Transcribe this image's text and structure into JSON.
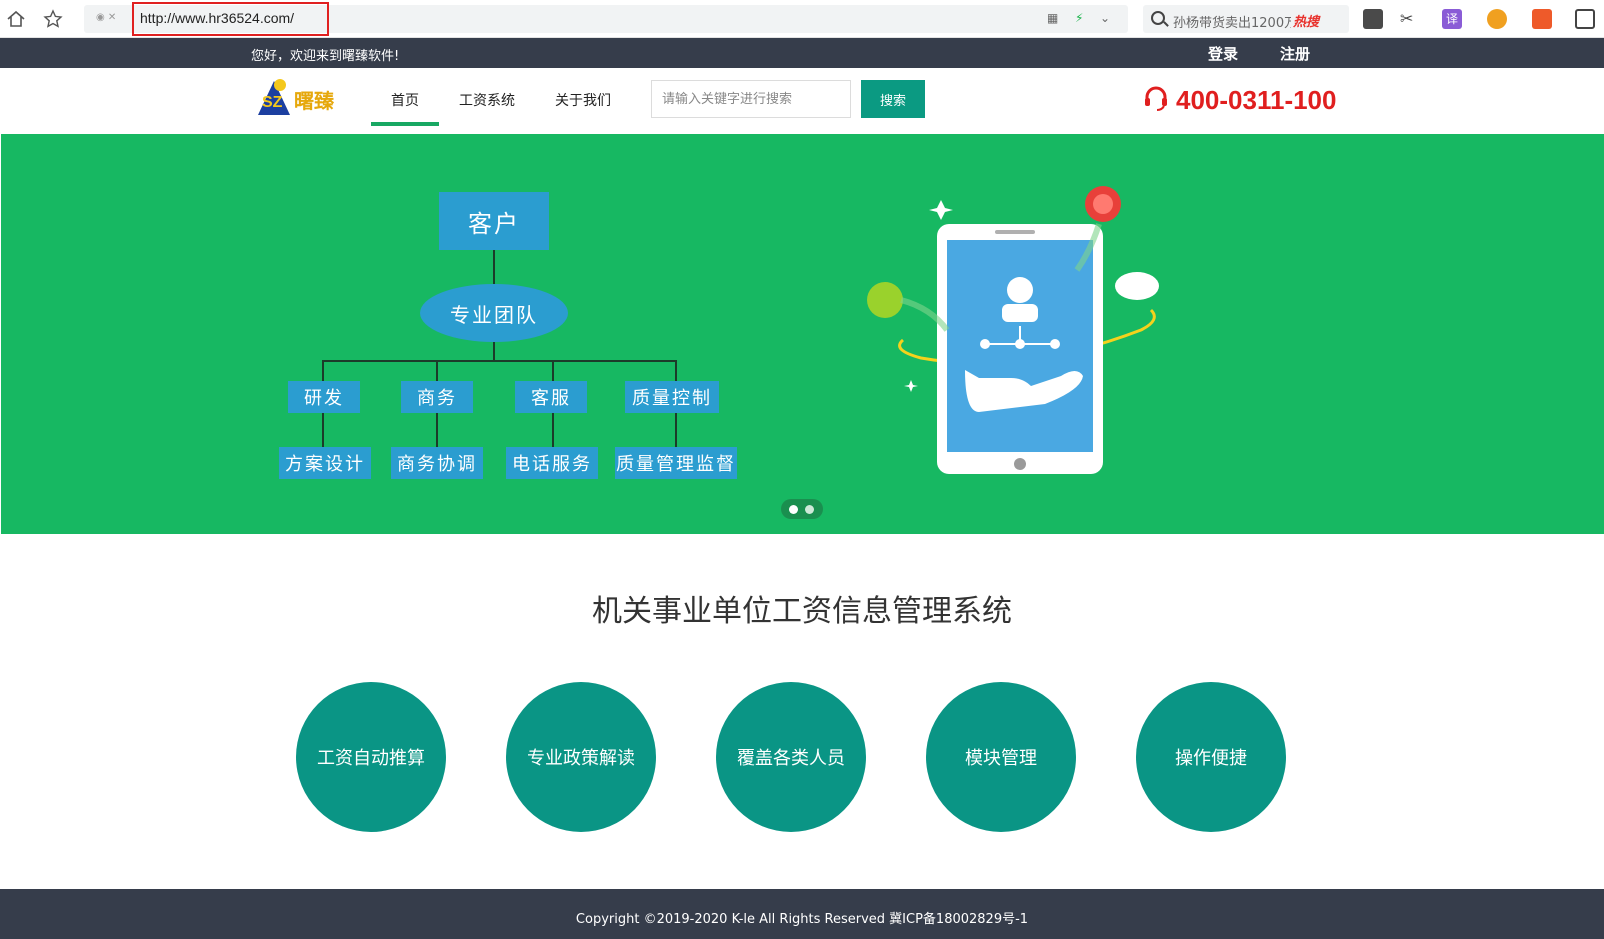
{
  "browser": {
    "url": "http://www.hr36524.com/",
    "search_text": "孙杨带货卖出1200万",
    "search_hot": "热搜"
  },
  "topbar": {
    "welcome": "您好，欢迎来到曙臻软件!",
    "login": "登录",
    "register": "注册"
  },
  "nav": {
    "items": [
      "首页",
      "工资系统",
      "关于我们"
    ],
    "search_placeholder": "请输入关键字进行搜索",
    "search_button": "搜索",
    "phone": "400-0311-100",
    "logo_text": "曙臻"
  },
  "banner": {
    "top": "客户",
    "team": "专业团队",
    "depts": [
      "研发",
      "商务",
      "客服",
      "质量控制"
    ],
    "tasks": [
      "方案设计",
      "商务协调",
      "电话服务",
      "质量管理监督"
    ]
  },
  "main": {
    "headline": "机关事业单位工资信息管理系统",
    "features": [
      "工资自动推算",
      "专业政策解读",
      "覆盖各类人员",
      "模块管理",
      "操作便捷"
    ]
  },
  "footer": {
    "copyright": "Copyright ©2019-2020 K-le All Rights Reserved  冀ICP备18002829号-1"
  },
  "colors": {
    "banner": "#17b862",
    "accent": "#0b9a82",
    "topbar": "#363d4b",
    "phone": "#e01f1f"
  }
}
